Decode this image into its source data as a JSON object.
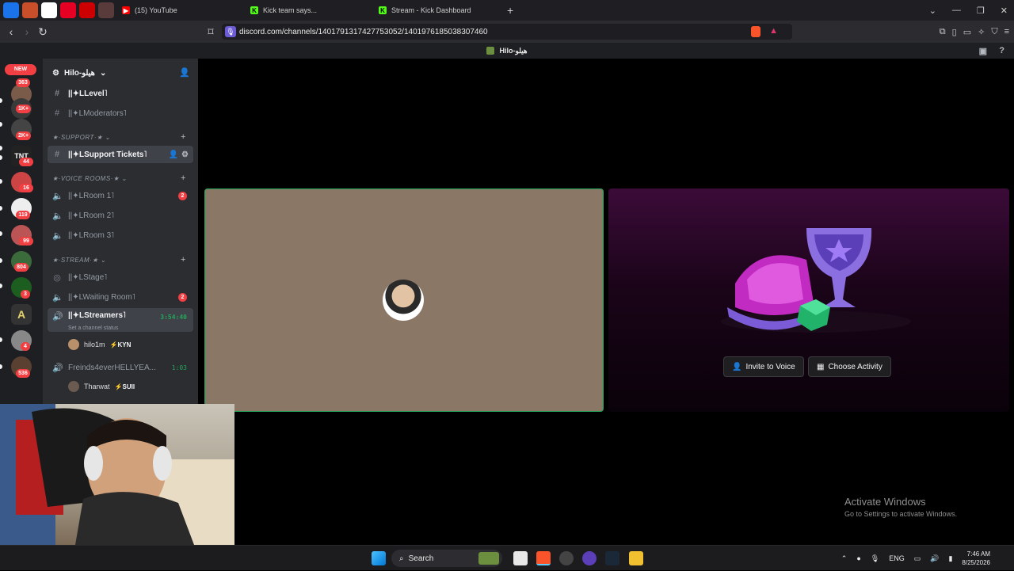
{
  "browser": {
    "tabs": [
      {
        "label": "(15) YouTube",
        "fav": "Y",
        "color": "#ff0000"
      },
      {
        "label": "Kick team says...",
        "fav": "K",
        "color": "#53fc18"
      },
      {
        "label": "Stream - Kick Dashboard",
        "fav": "K",
        "color": "#53fc18"
      }
    ],
    "new_tab": "+",
    "url": "discord.com/channels/1401791317427753052/1401976185038307460"
  },
  "discord": {
    "window_title": "Hilo-هيلو",
    "server_name": "Hilo-هيلو",
    "rail": {
      "new_label": "NEW",
      "badges": [
        "363",
        "1K+",
        "2K+",
        "44",
        "16",
        "119",
        "99",
        "804",
        "3",
        "4",
        "536"
      ]
    },
    "categories": {
      "support": "SUPPORT",
      "voice": "VOICE ROOMS",
      "stream": "STREAM"
    },
    "channels": {
      "level": "||✦LLevel˥",
      "moderators": "||✦LModerators˥",
      "support_tickets": "||✦LSupport Tickets˥",
      "room1": "||✦LRoom 1˥",
      "room1_badge": "2",
      "room2": "||✦LRoom 2˥",
      "room3": "||✦LRoom 3˥",
      "stage": "||✦LStage˥",
      "waiting": "||✦LWaiting Room˥",
      "waiting_badge": "2",
      "streamers": "||✦LStreamers˥",
      "streamers_timer": "3:54:40",
      "streamers_status": "Set a channel status",
      "member1": "hilo1m",
      "member1_tag": "⚡KYN",
      "friends": "Freinds4everHELLYEA...",
      "friends_timer": "1:03",
      "member2": "Tharwat",
      "member2_tag": "⚡SUII"
    },
    "activity": {
      "invite_label": "Invite to Voice",
      "choose_label": "Choose Activity"
    }
  },
  "watermark": {
    "line1": "Activate Windows",
    "line2": "Go to Settings to activate Windows."
  },
  "taskbar": {
    "search": "Search",
    "lang": "ENG",
    "time": "7:46 AM",
    "date": "8/25/2026"
  }
}
